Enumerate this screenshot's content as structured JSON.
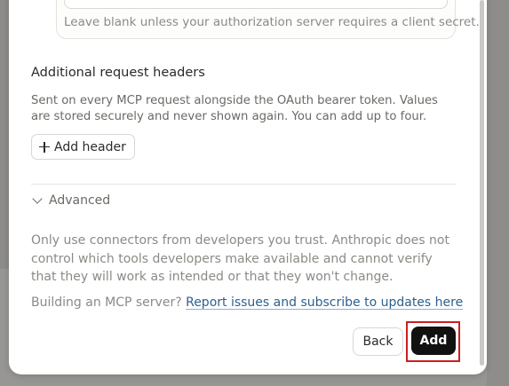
{
  "client_secret": {
    "hint": "Leave blank unless your authorization server requires a client secret."
  },
  "headers_section": {
    "title": "Additional request headers",
    "description": "Sent on every MCP request alongside the OAuth bearer token. Values are stored securely and never shown again. You can add up to four.",
    "add_header_label": "Add header"
  },
  "advanced": {
    "label": "Advanced"
  },
  "notice": {
    "warning": "Only use connectors from developers you trust. Anthropic does not control which tools developers make available and cannot verify that they will work as intended or that they won't change.",
    "build_prefix": "Building an MCP server?",
    "build_link": "Report issues and subscribe to updates here"
  },
  "footer": {
    "back_label": "Back",
    "add_label": "Add"
  },
  "colors": {
    "highlight": "#cc1f1f",
    "primary_button": "#111111",
    "link": "#2c5f8f"
  }
}
